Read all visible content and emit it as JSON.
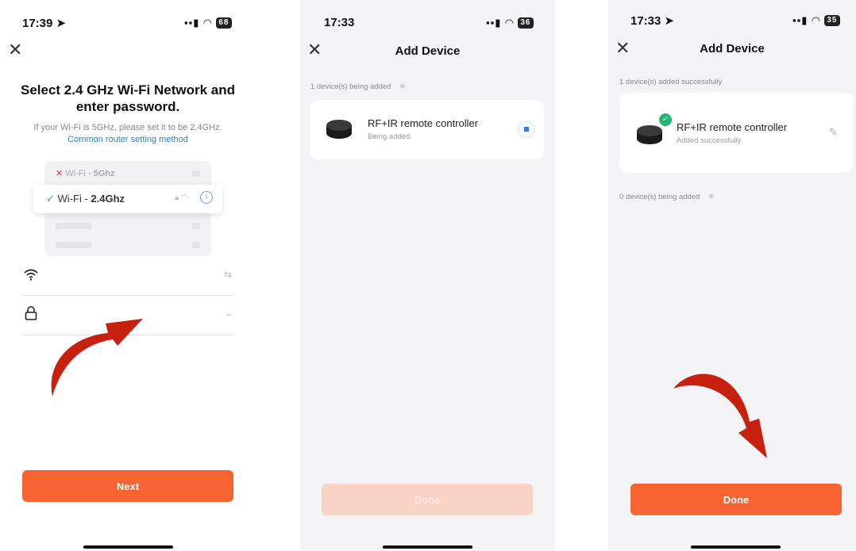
{
  "panel1": {
    "time": "17:39",
    "battery": "68",
    "title": "Select 2.4 GHz Wi-Fi Network and enter password.",
    "subtitle": "If your Wi-Fi is 5GHz, please set it to be 2.4GHz.",
    "router_link": "Common router setting method",
    "wifi_bad_prefix": "Wi-Fi - ",
    "wifi_bad_band": "5Ghz",
    "wifi_good_prefix": "Wi-Fi - ",
    "wifi_good_band": "2.4Ghz",
    "next_label": "Next"
  },
  "panel2": {
    "time": "17:33",
    "battery": "36",
    "nav_title": "Add Device",
    "section_label": "1 device(s) being added",
    "device_name": "RF+IR remote controller",
    "device_status": "Being added",
    "done_label": "Done"
  },
  "panel3": {
    "time": "17:33",
    "battery": "35",
    "nav_title": "Add Device",
    "success_label": "1 device(s) added successfully",
    "device_name": "RF+IR remote controller",
    "device_status": "Added successfully",
    "pending_label": "0 device(s) being added",
    "done_label": "Done"
  },
  "colors": {
    "accent": "#f76432",
    "link": "#2a7fd4",
    "success": "#22b573",
    "arrow": "#c8200f"
  }
}
